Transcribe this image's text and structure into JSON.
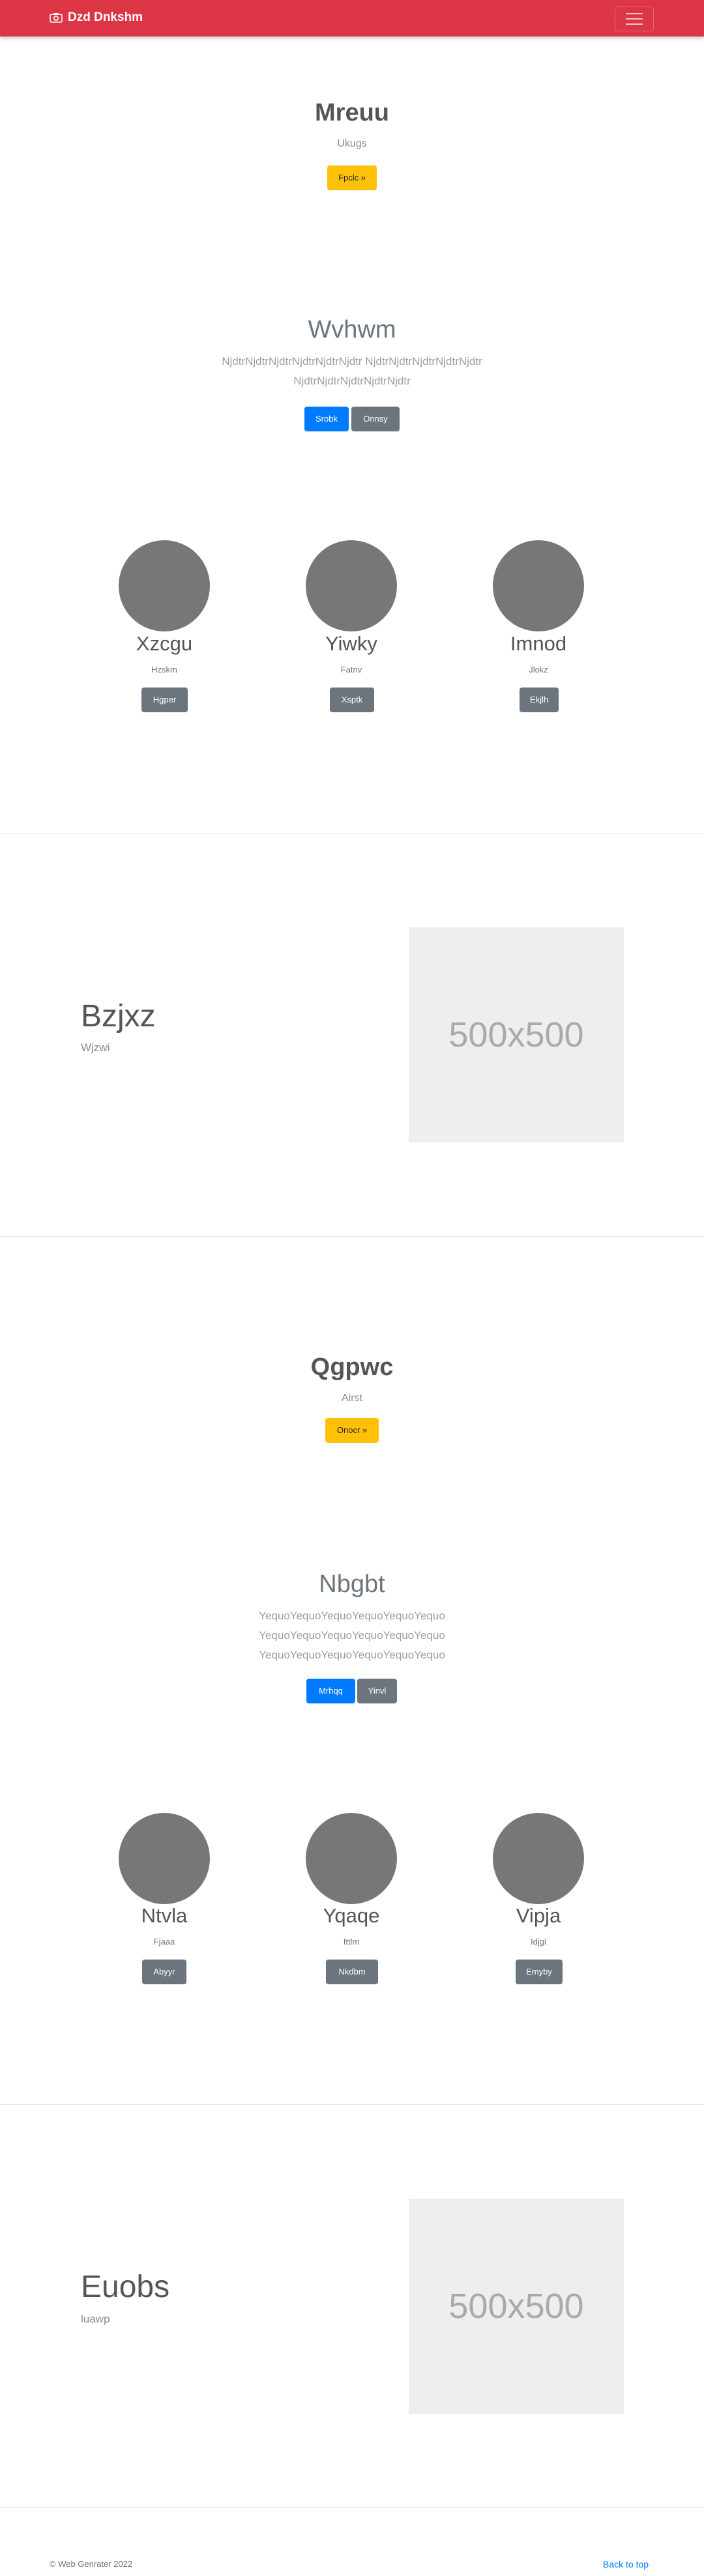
{
  "navbar": {
    "brand": "Dzd Dnkshm",
    "brand_icon": "camera-icon",
    "toggler_icon": "hamburger-icon",
    "bg_color": "#dc3545"
  },
  "section1": {
    "title": "Mreuu",
    "subtitle": "Ukugs",
    "button": "Fpclc »"
  },
  "section2": {
    "title": "Wvhwm",
    "paragraph_line1": "NjdtrNjdtrNjdtrNjdtrNjdtrNjdtr NjdtrNjdtrNjdtrNjdtrNjdtr",
    "paragraph_line2": "NjdtrNjdtrNjdtrNjdtrNjdtr",
    "primary_button": "Srobk",
    "secondary_button": "Onnsy"
  },
  "columns1": [
    {
      "title": "Xzcgu",
      "subtitle": "Hzskm",
      "button": "Hgper"
    },
    {
      "title": "Yiwky",
      "subtitle": "Fatnv",
      "button": "Xsptk"
    },
    {
      "title": "Imnod",
      "subtitle": "Jlokz",
      "button": "Ekjlh"
    }
  ],
  "feature1": {
    "title": "Bzjxz",
    "subtitle": "Wjzwi",
    "image_label": "500x500"
  },
  "section3": {
    "title": "Qgpwc",
    "subtitle": "Airst",
    "button": "Onocr »"
  },
  "section4": {
    "title": "Nbgbt",
    "paragraph_line1": "YequoYequoYequoYequoYequoYequo",
    "paragraph_line2": "YequoYequoYequoYequoYequoYequo",
    "paragraph_line3": "YequoYequoYequoYequoYequoYequo",
    "primary_button": "Mrhqq",
    "secondary_button": "Yinvl"
  },
  "columns2": [
    {
      "title": "Ntvla",
      "subtitle": "Fjaaa",
      "button": "Abyyr"
    },
    {
      "title": "Yqaqe",
      "subtitle": "Ittlm",
      "button": "Nkdbm"
    },
    {
      "title": "Vipja",
      "subtitle": "Idjgi",
      "button": "Emyby"
    }
  ],
  "feature2": {
    "title": "Euobs",
    "subtitle": "luawp",
    "image_label": "500x500"
  },
  "footer": {
    "copyright": "© Web Genrater 2022",
    "back_to_top": "Back to top"
  }
}
